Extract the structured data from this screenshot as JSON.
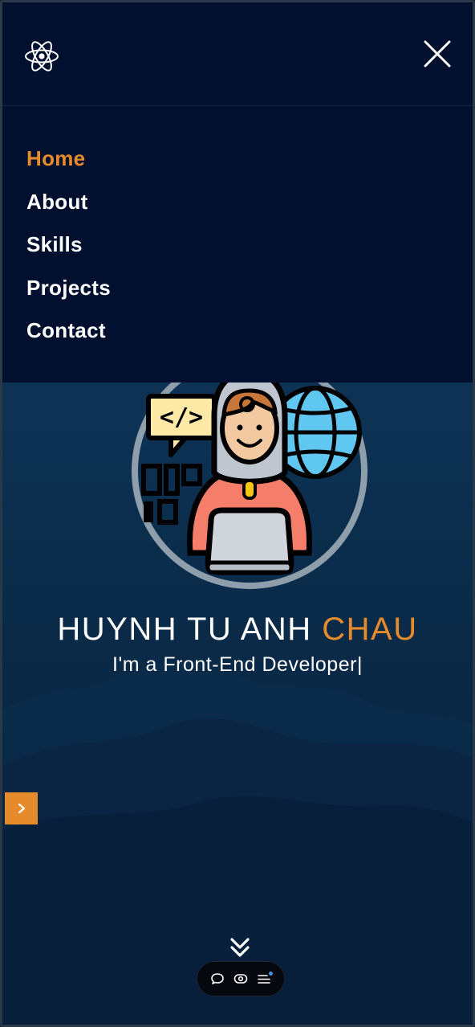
{
  "nav": {
    "logo_icon": "react-atom-icon",
    "close_icon": "close-icon",
    "items": [
      {
        "label": "Home",
        "active": true
      },
      {
        "label": "About",
        "active": false
      },
      {
        "label": "Skills",
        "active": false
      },
      {
        "label": "Projects",
        "active": false
      },
      {
        "label": "Contact",
        "active": false
      }
    ]
  },
  "hero": {
    "name_first": "HUYNH TU ANH",
    "name_accent": "CHAU",
    "subtitle": "I'm a Front-End Developer|",
    "avatar_icon": "developer-avatar-icon"
  },
  "controls": {
    "side_arrow_icon": "chevron-right-icon",
    "scroll_down_icon": "double-chevron-down-icon",
    "toolbar_icons": [
      "chat-bubble-icon",
      "eye-icon",
      "menu-list-icon"
    ]
  },
  "colors": {
    "accent": "#e68b2c",
    "nav_bg": "#02102f",
    "hero_bg": "#0d3253",
    "text": "#ffffff"
  }
}
